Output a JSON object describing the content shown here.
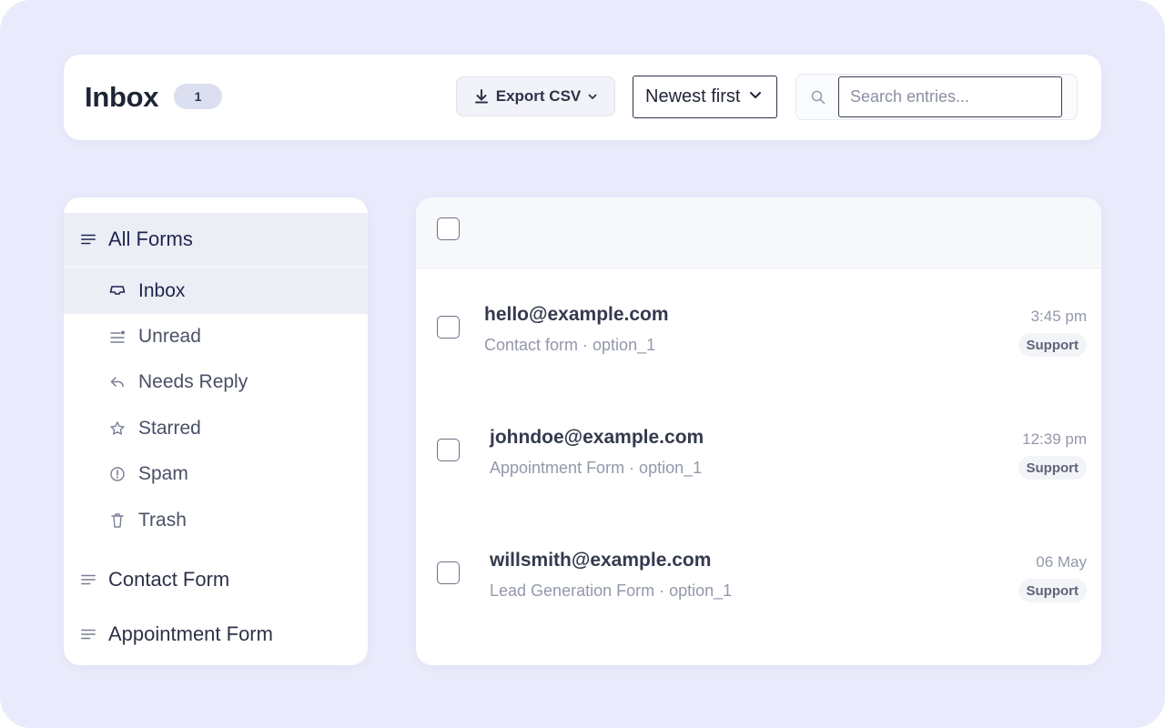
{
  "header": {
    "title": "Inbox",
    "count_badge": "1",
    "export_label": "Export CSV",
    "sort_value": "Newest first",
    "search_placeholder": "Search entries..."
  },
  "sidebar": {
    "groups": [
      {
        "label": "All Forms",
        "active": true
      },
      {
        "label": "Contact Form",
        "active": false
      },
      {
        "label": "Appointment Form",
        "active": false
      }
    ],
    "items": [
      {
        "label": "Inbox",
        "icon": "inbox-icon",
        "active": true
      },
      {
        "label": "Unread",
        "icon": "unread-icon",
        "active": false
      },
      {
        "label": "Needs Reply",
        "icon": "reply-icon",
        "active": false
      },
      {
        "label": "Starred",
        "icon": "star-icon",
        "active": false
      },
      {
        "label": "Spam",
        "icon": "spam-icon",
        "active": false
      },
      {
        "label": "Trash",
        "icon": "trash-icon",
        "active": false
      }
    ]
  },
  "entries": [
    {
      "email": "hello@example.com",
      "form": "Contact form · option_1",
      "time": "3:45 pm",
      "tag": "Support"
    },
    {
      "email": "johndoe@example.com",
      "form": "Appointment Form · option_1",
      "time": "12:39 pm",
      "tag": "Support"
    },
    {
      "email": "willsmith@example.com",
      "form": "Lead Generation Form · option_1",
      "time": "06 May",
      "tag": "Support"
    }
  ],
  "colors": {
    "page_bg": "#e9eafb",
    "active_bg": "#eceef5",
    "active_text": "#1f2550",
    "badge_bg": "#dcdff0"
  }
}
